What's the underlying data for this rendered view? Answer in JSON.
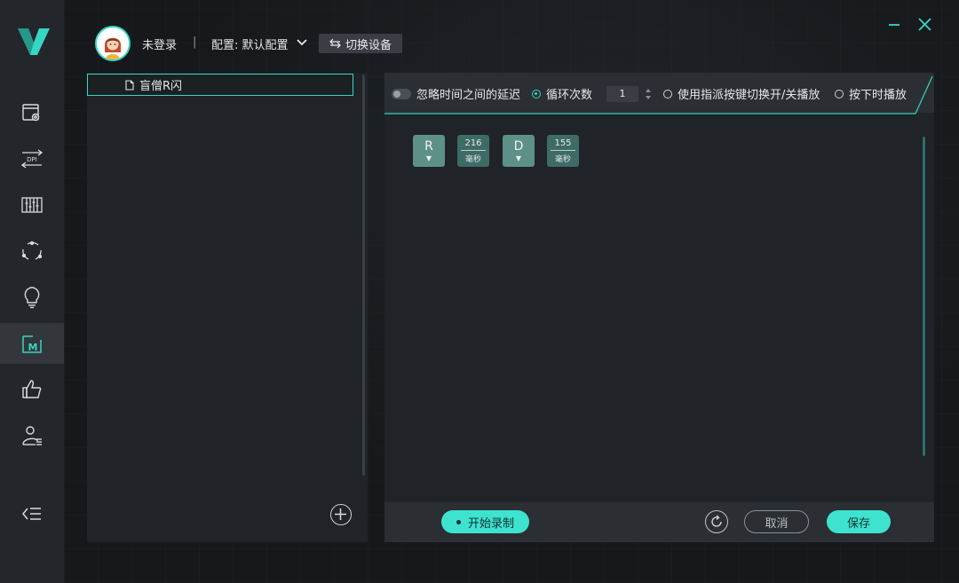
{
  "header": {
    "login_status": "未登录",
    "separator": "|",
    "profile_label": "配置: 默认配置",
    "switch_device_label": "切换设备"
  },
  "sidebar": {
    "items": [
      {
        "icon": "device-settings-icon"
      },
      {
        "icon": "dpi-icon",
        "label": "DPI"
      },
      {
        "icon": "equalizer-icon"
      },
      {
        "icon": "sync-icon"
      },
      {
        "icon": "lightbulb-icon"
      },
      {
        "icon": "macro-icon",
        "label": "M",
        "active": true
      },
      {
        "icon": "thumbs-up-icon"
      },
      {
        "icon": "user-manage-icon"
      }
    ]
  },
  "macro_list": {
    "items": [
      {
        "label": "盲僧R闪",
        "selected": true
      }
    ]
  },
  "toolbar": {
    "ignore_delay_label": "忽略时间之间的延迟",
    "loop_count_label": "循环次数",
    "loop_count_value": "1",
    "toggle_play_label": "使用指派按键切换开/关播放",
    "press_play_label": "按下时播放"
  },
  "sequence": [
    {
      "type": "key",
      "key": "R",
      "action": "▼"
    },
    {
      "type": "delay",
      "value": "216",
      "unit": "毫秒"
    },
    {
      "type": "key",
      "key": "D",
      "action": "▼"
    },
    {
      "type": "delay",
      "value": "155",
      "unit": "毫秒"
    }
  ],
  "bottom": {
    "record_label": "开始录制",
    "cancel_label": "取消",
    "save_label": "保存"
  },
  "colors": {
    "accent": "#3de3cf",
    "key_chip": "#5d9188",
    "delay_chip": "#3e6b65"
  }
}
